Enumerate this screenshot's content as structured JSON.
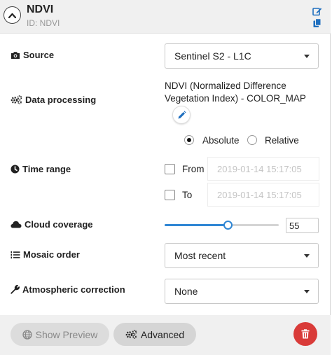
{
  "header": {
    "title": "NDVI",
    "subtitle": "ID: NDVI"
  },
  "source": {
    "label": "Source",
    "value": "Sentinel S2 - L1C"
  },
  "data_processing": {
    "label": "Data processing",
    "value": "NDVI (Normalized Difference Vegetation Index) - COLOR_MAP",
    "options": [
      {
        "label": "Absolute",
        "selected": true
      },
      {
        "label": "Relative",
        "selected": false
      }
    ]
  },
  "time_range": {
    "label": "Time range",
    "from_label": "From",
    "from_placeholder": "2019-01-14 15:17:05",
    "to_label": "To",
    "to_placeholder": "2019-01-14 15:17:05"
  },
  "cloud_coverage": {
    "label": "Cloud coverage",
    "value": "55",
    "fraction": 0.55
  },
  "mosaic_order": {
    "label": "Mosaic order",
    "value": "Most recent"
  },
  "atmospheric_correction": {
    "label": "Atmospheric correction",
    "value": "None"
  },
  "footer": {
    "preview_label": "Show Preview",
    "advanced_label": "Advanced"
  },
  "colors": {
    "accent": "#2f86d4",
    "delete": "#d93b39",
    "header_bg": "#f0f0f0"
  },
  "icons": [
    "chevron-up-icon",
    "edit-icon",
    "copy-icon",
    "camera-icon",
    "cogs-icon",
    "pencil-icon",
    "clock-icon",
    "cloud-icon",
    "list-ordered-icon",
    "wrench-icon",
    "globe-icon",
    "trash-icon"
  ]
}
